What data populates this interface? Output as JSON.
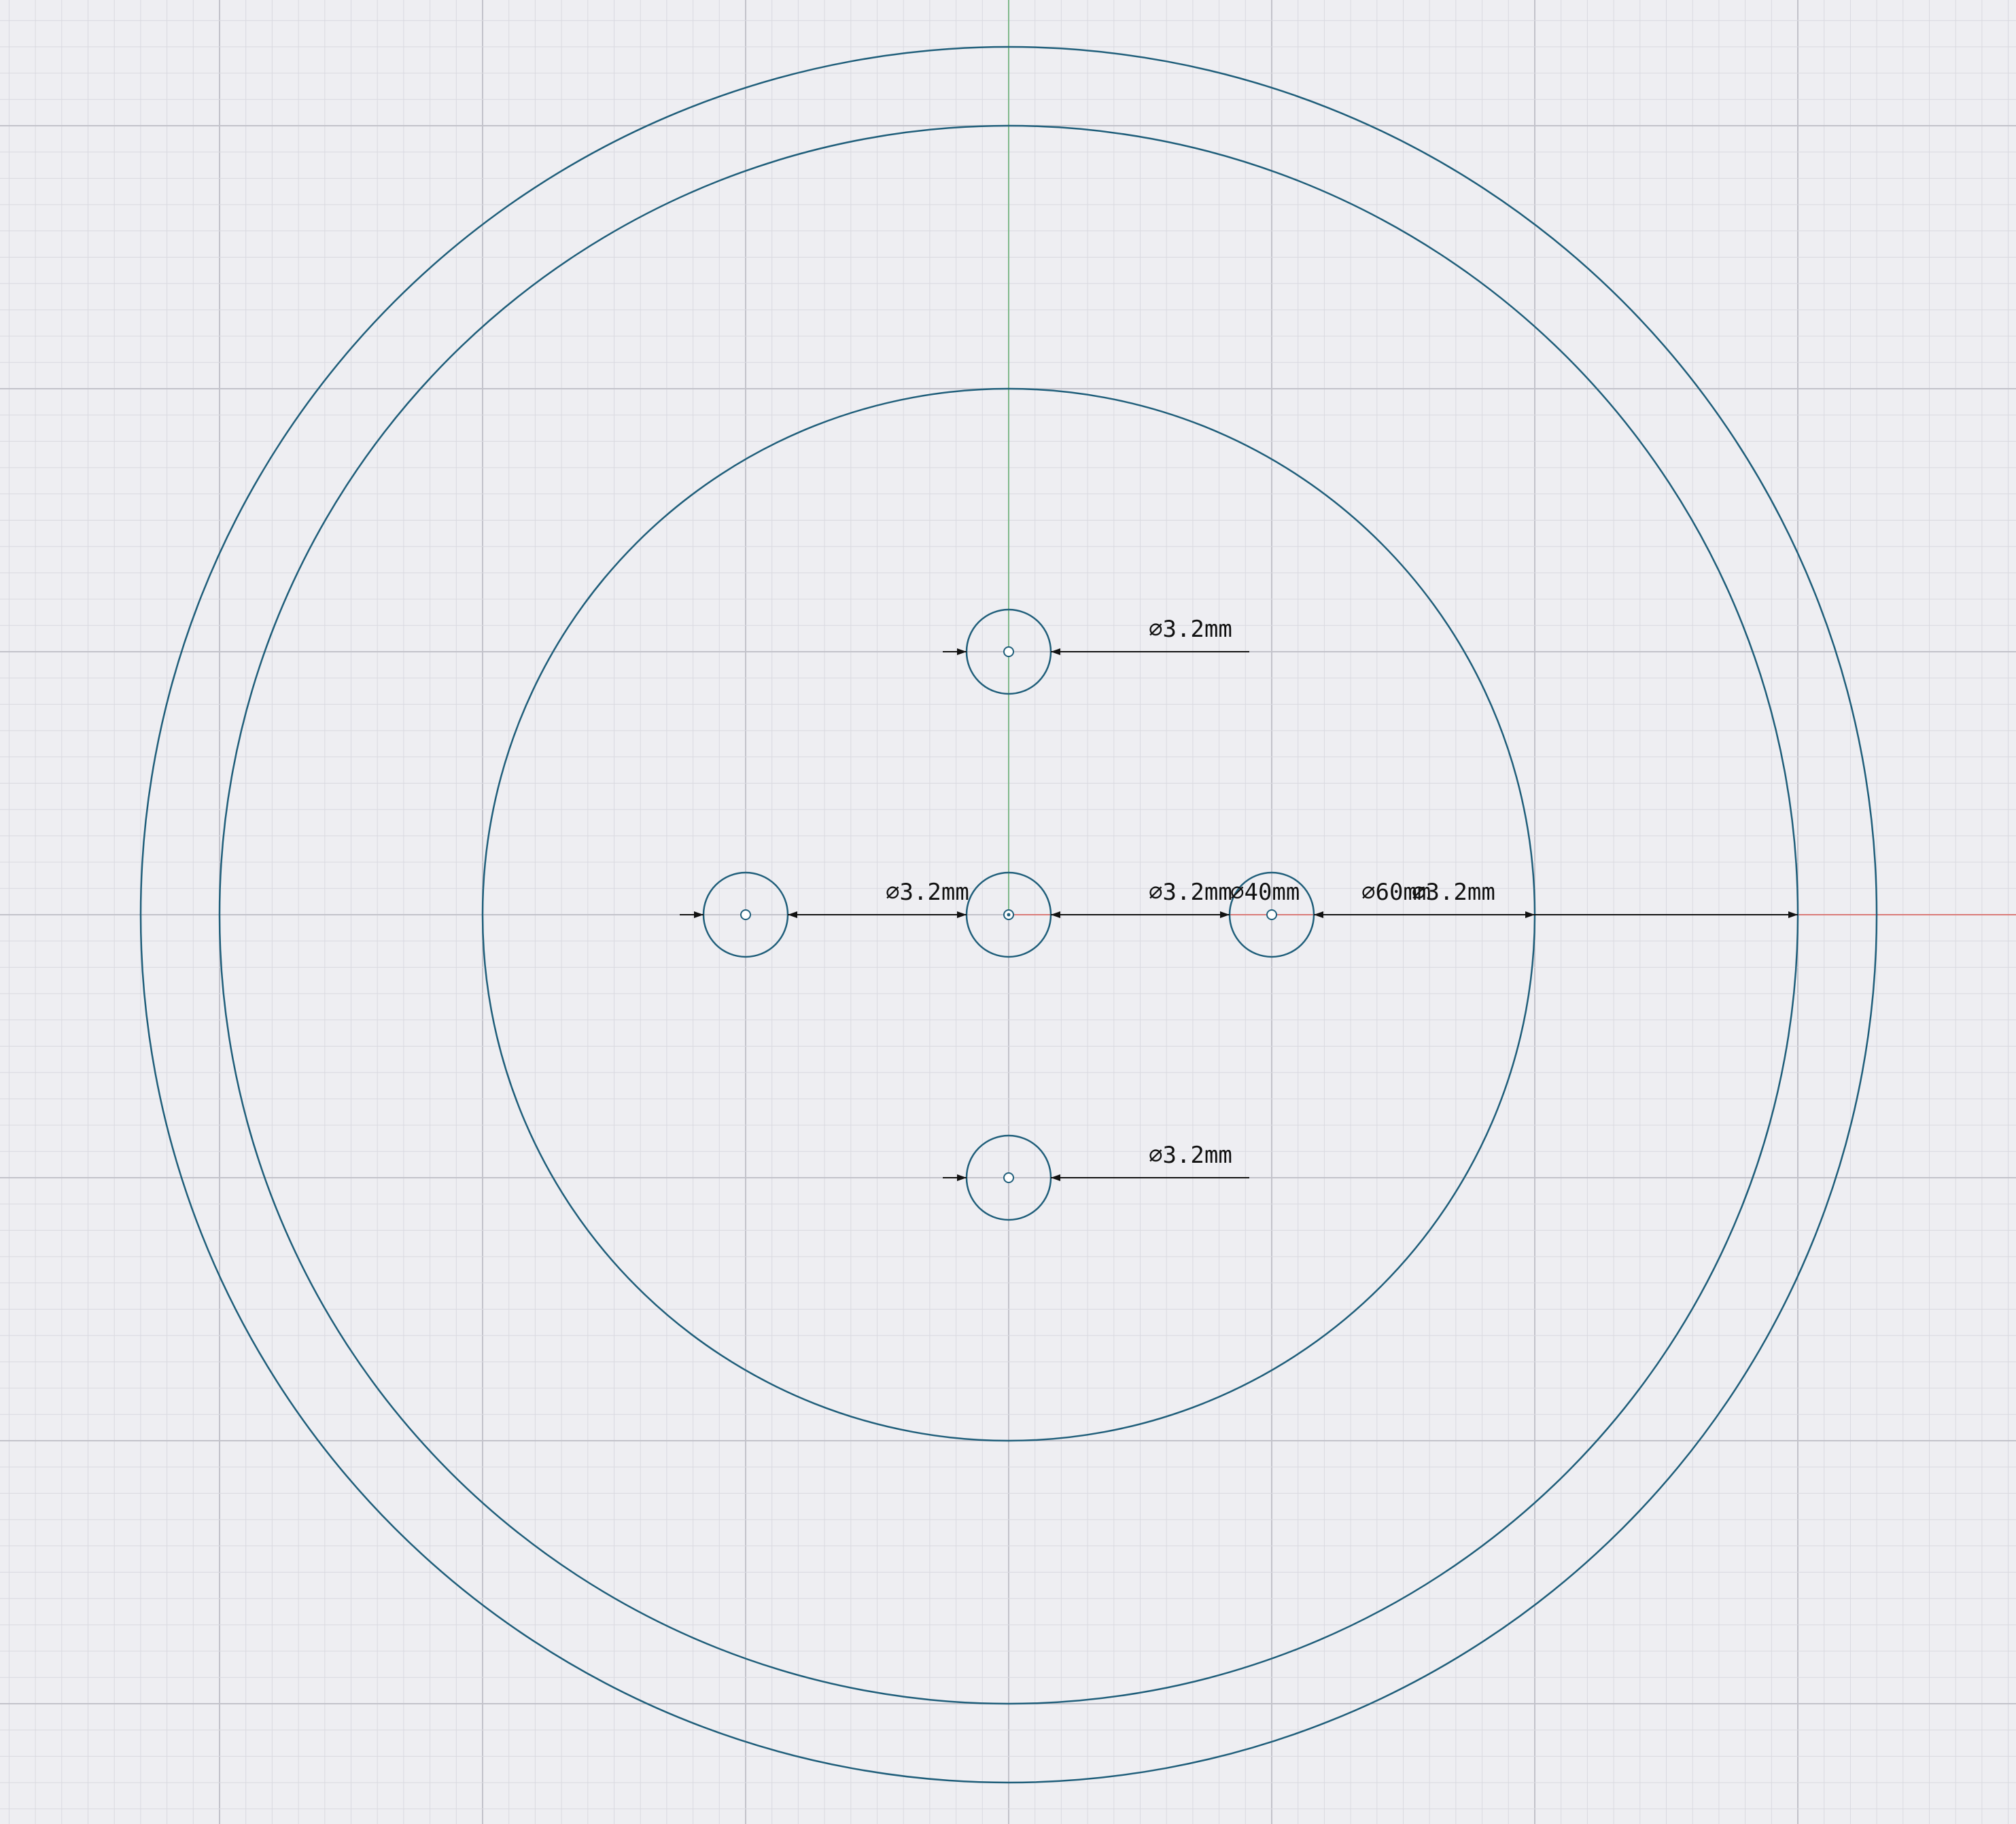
{
  "colors": {
    "background": "#eeeef2",
    "grid_minor": "#d9d9e0",
    "grid_major": "#c2c2ca",
    "sketch_line": "#1f5e7a",
    "y_axis": "#7fb88a",
    "x_axis": "#d97a78",
    "dimension": "#111111"
  },
  "units": "mm",
  "circles": [
    {
      "id": "outer-ring",
      "diameter_mm": 66
    },
    {
      "id": "inner-ring",
      "diameter_mm": 60
    },
    {
      "id": "center-bore",
      "diameter_mm": 40
    },
    {
      "id": "hole-top",
      "diameter_mm": 3.2
    },
    {
      "id": "hole-left",
      "diameter_mm": 3.2
    },
    {
      "id": "hole-center",
      "diameter_mm": 3.2
    },
    {
      "id": "hole-right",
      "diameter_mm": 3.2
    },
    {
      "id": "hole-bottom",
      "diameter_mm": 3.2
    }
  ],
  "dimensions": {
    "hole_top": "⌀3.2mm",
    "hole_left": "⌀3.2mm",
    "hole_center": "⌀3.2mm",
    "bore": "⌀40mm",
    "ring": "⌀60mm",
    "hole_right": "⌀3.2mm",
    "hole_bottom": "⌀3.2mm"
  }
}
